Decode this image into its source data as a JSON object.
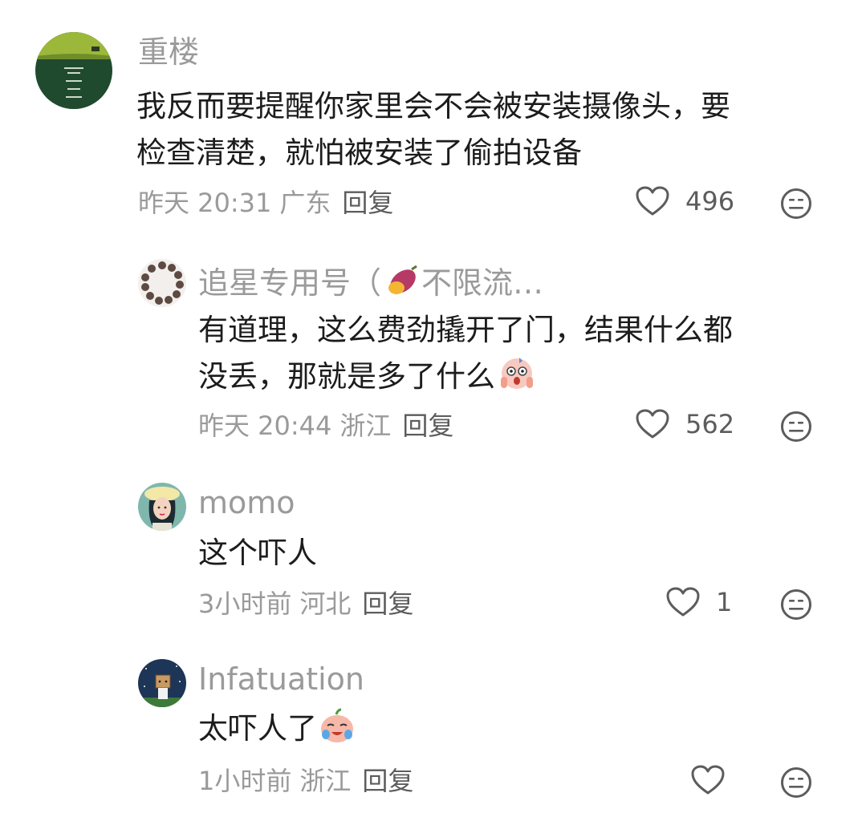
{
  "comments": [
    {
      "username": "重楼",
      "avatar_icon": "green-landscape-avatar",
      "text_lines": [
        "我反而要提醒你家里会不会被安装摄像头，要",
        "检查清楚，就怕被安装了偷拍设备"
      ],
      "time": "昨天 20:31",
      "location": "广东",
      "reply_label": "回复",
      "likes": "496"
    },
    {
      "username": "追星专用号（",
      "username_emoji": "sweet-potato-emoji",
      "username_suffix": "不限流…",
      "avatar_icon": "ring-beads-avatar",
      "text_lines": [
        "有道理，这么费劲撬开了门，结果什么都",
        "没丢，那就是多了什么"
      ],
      "text_emoji": "scared-face-emoji",
      "time": "昨天 20:44",
      "location": "浙江",
      "reply_label": "回复",
      "likes": "562"
    },
    {
      "username": "momo",
      "avatar_icon": "girl-illustration-avatar",
      "text_lines": [
        "这个吓人"
      ],
      "time": "3小时前",
      "location": "河北",
      "reply_label": "回复",
      "likes": "1"
    },
    {
      "username": "Infatuation",
      "avatar_icon": "night-sky-box-avatar",
      "text_lines": [
        "太吓人了"
      ],
      "text_emoji": "crying-laugh-emoji",
      "time": "1小时前",
      "location": "浙江",
      "reply_label": "回复",
      "likes": ""
    }
  ],
  "icons": {
    "like": "heart-outline-icon",
    "dislike": "meh-face-icon"
  },
  "colors": {
    "meta_text": "#9a9a9a",
    "body_text": "#1c1c1c",
    "icon": "#5c5c5c"
  }
}
